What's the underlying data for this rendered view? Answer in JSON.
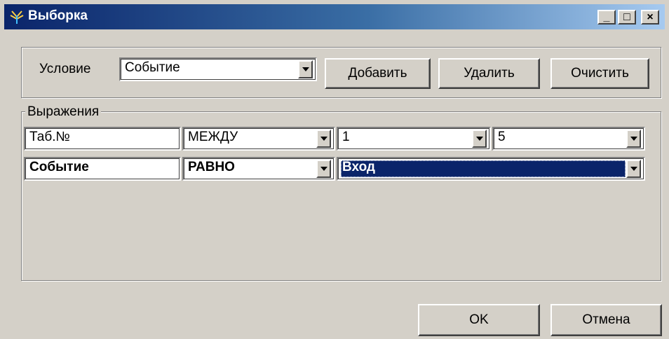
{
  "window": {
    "title": "Выборка",
    "controls": {
      "minimize": "_",
      "maximize": "□",
      "close": "×"
    }
  },
  "condition": {
    "label": "Условие",
    "value": "Событие"
  },
  "buttons": {
    "add": "Добавить",
    "delete": "Удалить",
    "clear": "Очистить",
    "ok": "OK",
    "cancel": "Отмена"
  },
  "expressions": {
    "label": "Выражения",
    "rows": [
      {
        "field": "Таб.№",
        "operator": "МЕЖДУ",
        "value1": "1",
        "value2": "5",
        "bold": false
      },
      {
        "field": "Событие",
        "operator": "РАВНО",
        "value1": "Вход",
        "bold": true,
        "selected": true
      }
    ]
  },
  "colors": {
    "window_bg": "#d4d0c8",
    "title_gradient_start": "#0a246a",
    "title_gradient_end": "#a6caf0",
    "selection": "#0a246a"
  },
  "icons": {
    "app": "antenna-icon",
    "dropdown": "chevron-down-icon"
  }
}
